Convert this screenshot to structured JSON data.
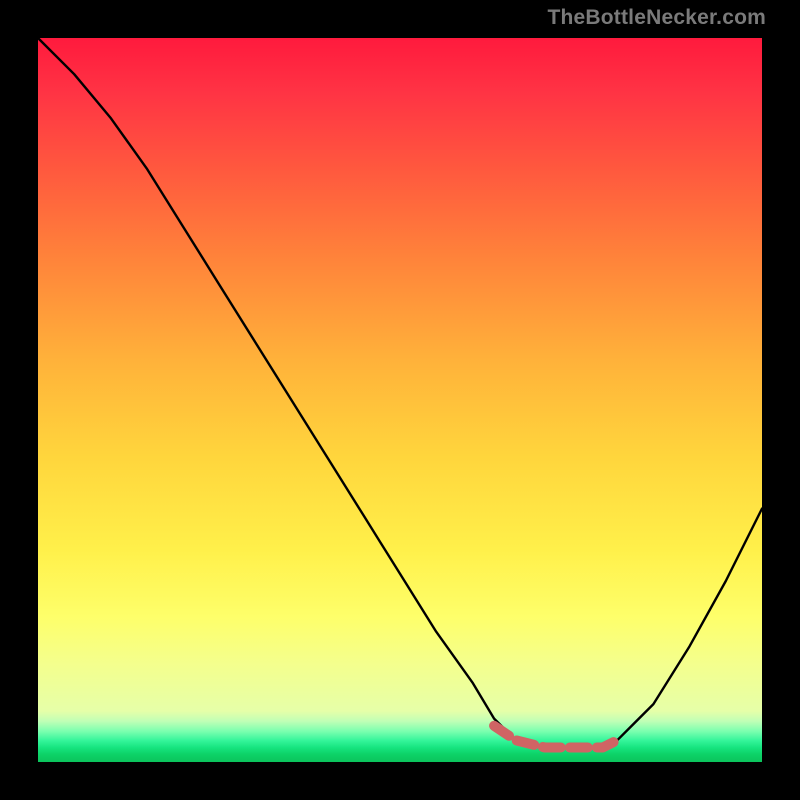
{
  "watermark": "TheBottleNecker.com",
  "chart_data": {
    "type": "line",
    "title": "",
    "xlabel": "",
    "ylabel": "",
    "xlim": [
      0,
      100
    ],
    "ylim": [
      0,
      100
    ],
    "series": [
      {
        "name": "bottleneck-curve",
        "x": [
          0,
          5,
          10,
          15,
          20,
          25,
          30,
          35,
          40,
          45,
          50,
          55,
          60,
          63,
          66,
          70,
          74,
          78,
          80,
          85,
          90,
          95,
          100
        ],
        "values": [
          100,
          95,
          89,
          82,
          74,
          66,
          58,
          50,
          42,
          34,
          26,
          18,
          11,
          6,
          3,
          2,
          2,
          2,
          3,
          8,
          16,
          25,
          35
        ]
      }
    ],
    "highlight": {
      "name": "trough-highlight",
      "x": [
        63,
        66,
        70,
        74,
        78,
        80
      ],
      "values": [
        5,
        3,
        2,
        2,
        2,
        3
      ]
    }
  }
}
